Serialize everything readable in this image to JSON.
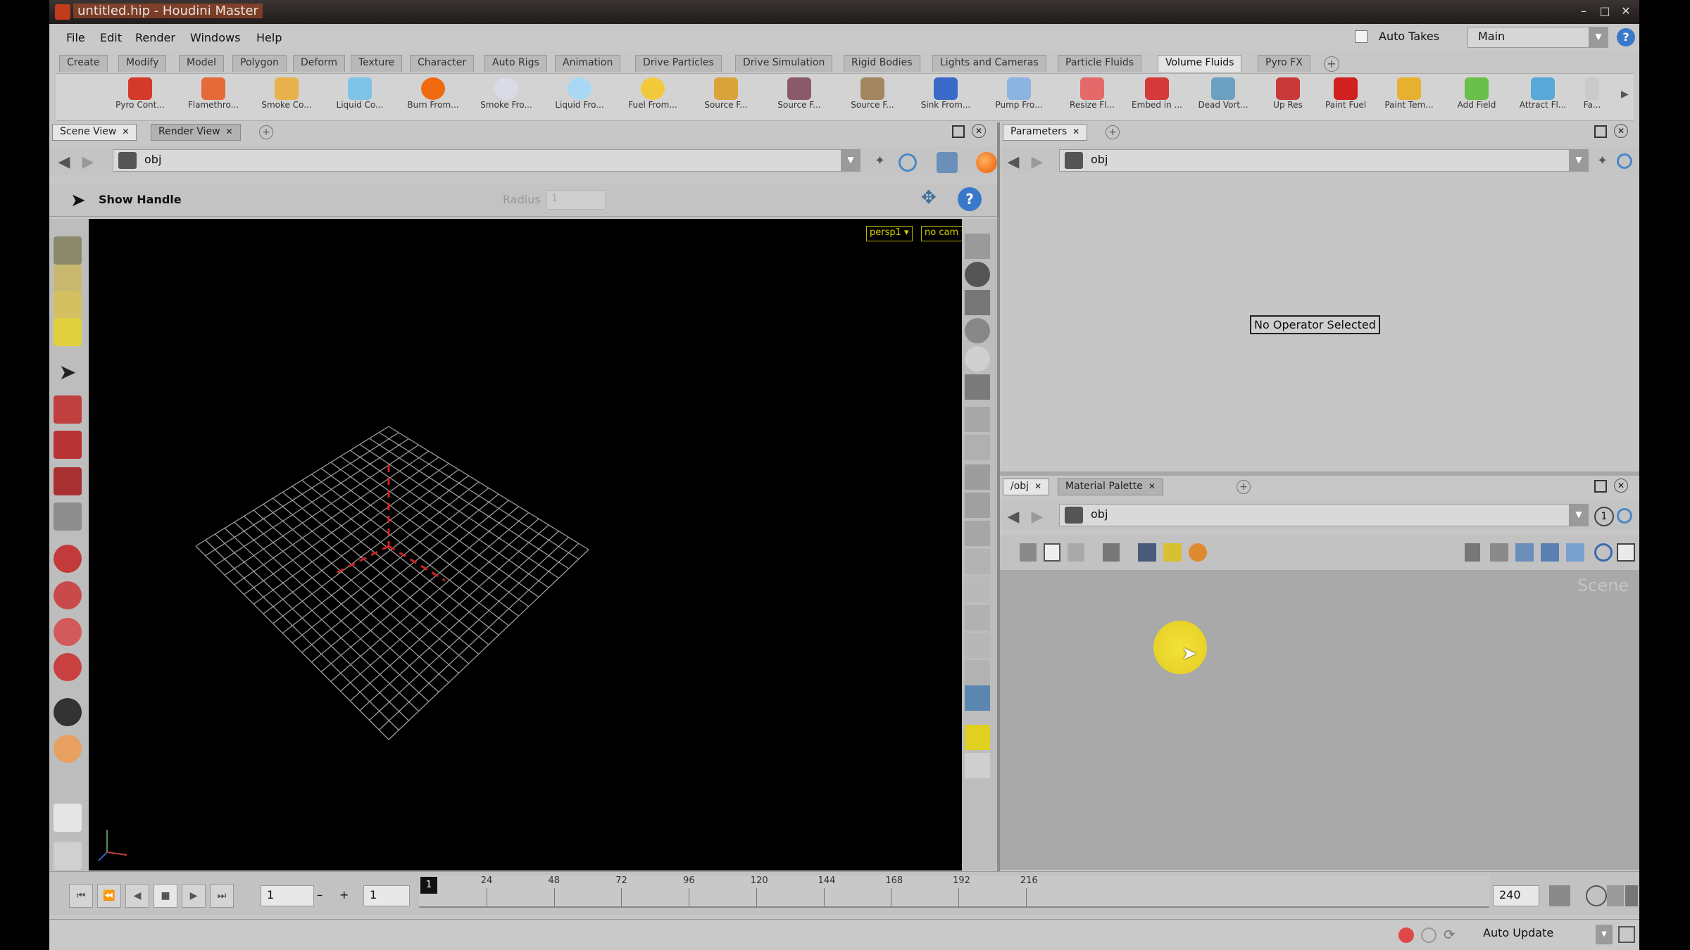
{
  "window": {
    "title": "untitled.hip - Houdini Master"
  },
  "menu": [
    "File",
    "Edit",
    "Render",
    "Windows",
    "Help"
  ],
  "auto_takes_label": "Auto Takes",
  "desktop": "Main",
  "shelf_tabs": [
    "Create",
    "Modify",
    "Model",
    "Polygon",
    "Deform",
    "Texture",
    "Character",
    "Auto Rigs",
    "Animation",
    "Drive Particles",
    "Drive Simulation",
    "Rigid Bodies",
    "Lights and Cameras",
    "Particle Fluids",
    "Volume Fluids",
    "Pyro FX"
  ],
  "active_shelf_tab": "Volume Fluids",
  "shelf_tools": [
    {
      "label": "Pyro Cont...",
      "color": "#d33a2a"
    },
    {
      "label": "Flamethro...",
      "color": "#e46a3a"
    },
    {
      "label": "Smoke Co...",
      "color": "#e8b24a"
    },
    {
      "label": "Liquid Co...",
      "color": "#7fc3e8"
    },
    {
      "label": "Burn From...",
      "color": "#f06a10"
    },
    {
      "label": "Smoke Fro...",
      "color": "#d9dbe6"
    },
    {
      "label": "Liquid Fro...",
      "color": "#a9d8f4"
    },
    {
      "label": "Fuel From...",
      "color": "#f2c93a"
    },
    {
      "label": "Source F...",
      "color": "#d8a43a"
    },
    {
      "label": "Source F...",
      "color": "#8a5a6a"
    },
    {
      "label": "Source F...",
      "color": "#a38760"
    },
    {
      "label": "Sink From...",
      "color": "#3a6ac8"
    },
    {
      "label": "Pump Fro...",
      "color": "#8db4e0"
    },
    {
      "label": "Resize Fl...",
      "color": "#e46a6a"
    },
    {
      "label": "Embed in ...",
      "color": "#d43a3a"
    },
    {
      "label": "Dead Vort...",
      "color": "#6aa0c0"
    },
    {
      "label": "Up Res",
      "color": "#c83a3a"
    },
    {
      "label": "Paint Fuel",
      "color": "#d02020"
    },
    {
      "label": "Paint Tem...",
      "color": "#e8b030"
    },
    {
      "label": "Add Field",
      "color": "#6ac04a"
    },
    {
      "label": "Attract Fl...",
      "color": "#5aa8d8"
    },
    {
      "label": "Fa...",
      "color": "#999999"
    }
  ],
  "left_pane": {
    "tabs": [
      "Scene View",
      "Render View"
    ],
    "path": "obj",
    "toolbar_label": "Show Handle",
    "radius_label": "Radius",
    "radius_value": "1",
    "view_badges": [
      "persp1 ▾",
      "no cam ▾"
    ]
  },
  "params_pane": {
    "tabs": [
      "Parameters"
    ],
    "path": "obj",
    "message": "No Operator Selected"
  },
  "network_pane": {
    "tabs": [
      "/obj",
      "Material Palette"
    ],
    "path": "obj",
    "watermark": "Scene"
  },
  "timeline": {
    "current_frame": "1",
    "start_frame": "1",
    "end_frame": "240",
    "marker": "1",
    "ticks": [
      "24",
      "48",
      "72",
      "96",
      "120",
      "144",
      "168",
      "192",
      "216"
    ],
    "tick_positions": [
      0.063,
      0.126,
      0.189,
      0.252,
      0.315,
      0.378,
      0.441,
      0.504,
      0.567
    ]
  },
  "status": {
    "update_mode": "Auto Update"
  },
  "colors": {
    "accent": "#3a78c9",
    "viewport": "#000000",
    "grid": "#9a9a9a",
    "axis": "#d42020",
    "badge": "#d6cf00",
    "cursor_highlight": "#f3e23a"
  }
}
